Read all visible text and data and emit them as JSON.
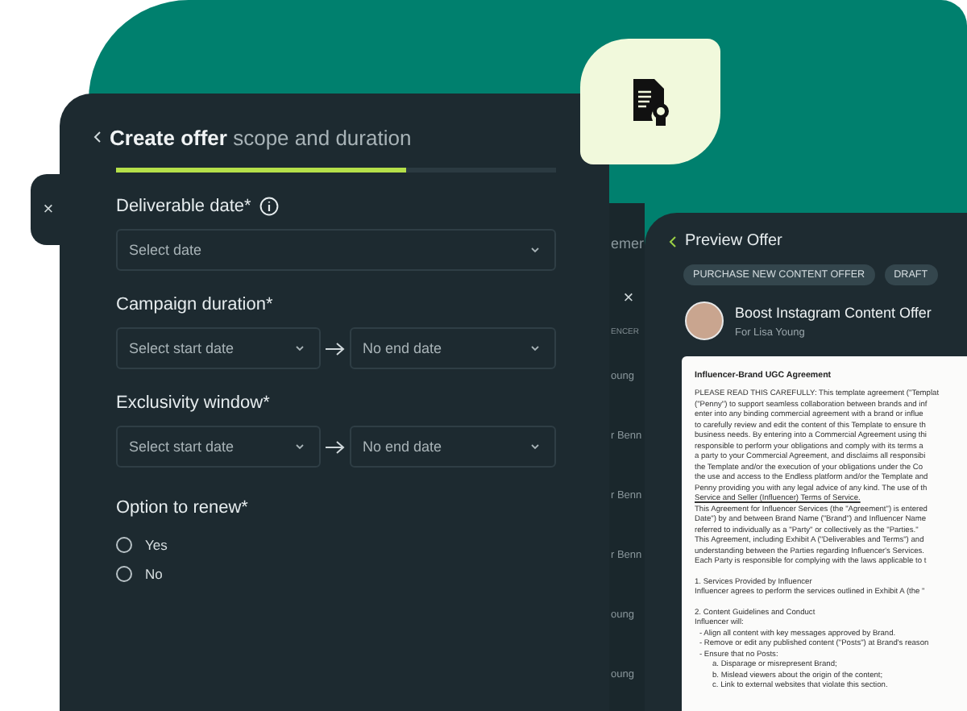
{
  "form": {
    "close": "×",
    "title": "Create offer",
    "subtitle": "scope and duration",
    "progress": {
      "level": 0.66
    },
    "fields": [
      {
        "kind": "single",
        "label": "Deliverable date*",
        "info": true,
        "placeholder": "Select date"
      },
      {
        "kind": "range",
        "label": "Campaign duration*",
        "start_placeholder": "Select start date",
        "end_placeholder": "No end date"
      },
      {
        "kind": "range",
        "label": "Exclusivity window*",
        "start_placeholder": "Select start date",
        "end_placeholder": "No end date"
      }
    ],
    "renew": {
      "label": "Option to renew*",
      "options": [
        {
          "label": "Yes",
          "selected": false
        },
        {
          "label": "No",
          "selected": false
        }
      ]
    }
  },
  "back_panel": {
    "heading": "emer",
    "close": "×",
    "column_label": "ENCER",
    "rows": [
      "oung",
      "r Benn",
      "r Benn",
      "r Benn",
      "oung",
      "oung"
    ]
  },
  "preview": {
    "title": "Preview Offer",
    "chips": [
      "PURCHASE NEW CONTENT OFFER",
      "DRAFT"
    ],
    "offer_title": "Boost Instagram Content Offer",
    "offer_for": "For Lisa Young",
    "document": {
      "title": "Influencer-Brand UGC Agreement",
      "lines": [
        {
          "kind": "body",
          "text": "PLEASE READ THIS CAREFULLY: This template agreement (\"Templat"
        },
        {
          "kind": "body",
          "text": "(\"Penny\") to support seamless collaboration between brands and inf"
        },
        {
          "kind": "body",
          "text": "enter into any binding commercial agreement with a brand or influe"
        },
        {
          "kind": "body",
          "text": "to carefully review and edit the content of this Template to ensure th"
        },
        {
          "kind": "body",
          "text": "business needs. By entering into a Commercial Agreement using thi"
        },
        {
          "kind": "body",
          "text": "responsible to perform your obligations and comply with its terms a"
        },
        {
          "kind": "body",
          "text": "a party to your Commercial Agreement, and disclaims all responsibi"
        },
        {
          "kind": "body",
          "text": "the Template and/or the execution of your obligations under the Co"
        },
        {
          "kind": "body",
          "text": "the use and access to the Endless platform and/or the Template and"
        },
        {
          "kind": "body",
          "text": "Penny providing you with any legal advice of any kind.  The use of th"
        },
        {
          "kind": "link",
          "text": "Service and Seller (Influencer) Terms of Service."
        },
        {
          "kind": "body",
          "text": "This Agreement for Influencer Services (the \"Agreement\") is entered"
        },
        {
          "kind": "body",
          "text": "Date\") by and between Brand Name (\"Brand\") and Influencer Name"
        },
        {
          "kind": "body",
          "text": "referred to individually as a \"Party\" or collectively as the \"Parties.\""
        },
        {
          "kind": "body",
          "text": "This Agreement, including Exhibit A (\"Deliverables and Terms\") and"
        },
        {
          "kind": "body",
          "text": "understanding between the Parties regarding Influencer's Services."
        },
        {
          "kind": "body",
          "text": "Each Party is responsible for complying with the laws applicable to t"
        },
        {
          "kind": "section",
          "text": "1. Services Provided by Influencer"
        },
        {
          "kind": "body",
          "text": "Influencer agrees to perform the services outlined in Exhibit A (the \""
        },
        {
          "kind": "section",
          "text": "2. Content Guidelines and Conduct"
        },
        {
          "kind": "body",
          "text": "Influencer will:"
        },
        {
          "kind": "bullet",
          "text": "- Align all content with key messages approved by Brand."
        },
        {
          "kind": "bullet",
          "text": "- Remove or edit any published content (\"Posts\") at Brand's reason"
        },
        {
          "kind": "bullet",
          "text": "- Ensure that no Posts:"
        },
        {
          "kind": "sub",
          "text": "a. Disparage or misrepresent Brand;"
        },
        {
          "kind": "sub",
          "text": "b. Mislead viewers about the origin of the content;"
        },
        {
          "kind": "sub",
          "text": "c. Link to external websites that violate this section."
        }
      ]
    }
  }
}
